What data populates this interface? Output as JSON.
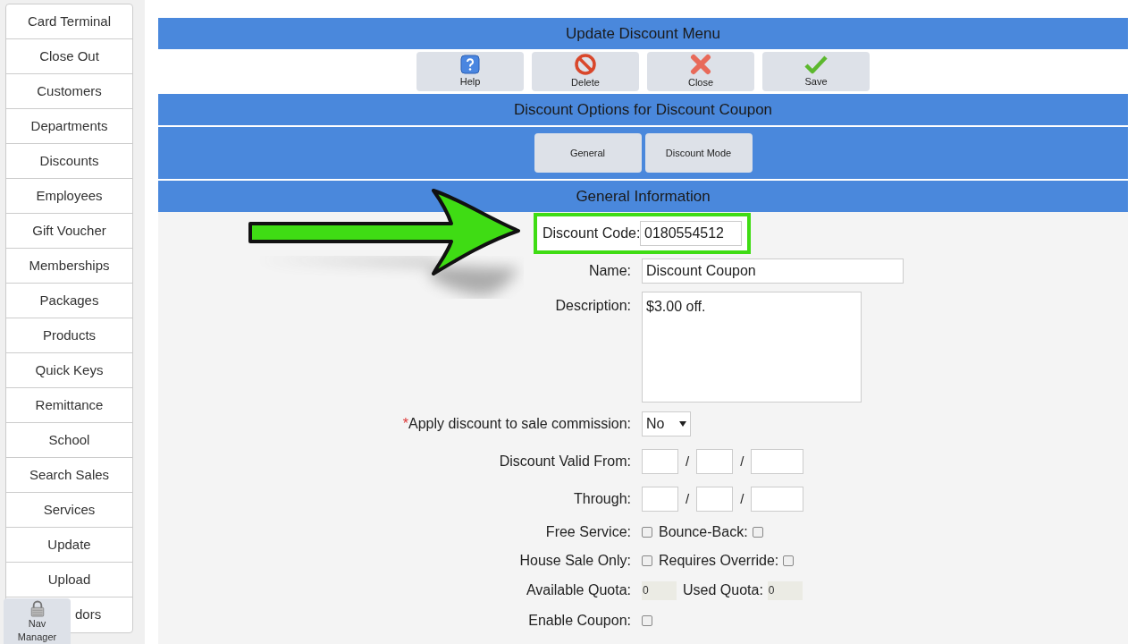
{
  "sidebar": {
    "items": [
      {
        "label": "Card Terminal"
      },
      {
        "label": "Close Out"
      },
      {
        "label": "Customers"
      },
      {
        "label": "Departments"
      },
      {
        "label": "Discounts"
      },
      {
        "label": "Employees"
      },
      {
        "label": "Gift Voucher"
      },
      {
        "label": "Memberships"
      },
      {
        "label": "Packages"
      },
      {
        "label": "Products"
      },
      {
        "label": "Quick Keys"
      },
      {
        "label": "Remittance"
      },
      {
        "label": "School"
      },
      {
        "label": "Search Sales"
      },
      {
        "label": "Services"
      },
      {
        "label": "Update"
      },
      {
        "label": "Upload"
      },
      {
        "label": "dors"
      }
    ],
    "nav_manager": {
      "label": "Nav Manager"
    }
  },
  "header": {
    "title": "Update Discount Menu"
  },
  "toolbar": [
    {
      "kind": "help",
      "label": "Help"
    },
    {
      "kind": "delete",
      "label": "Delete"
    },
    {
      "kind": "close",
      "label": "Close"
    },
    {
      "kind": "save",
      "label": "Save"
    }
  ],
  "options": {
    "title": "Discount Options for Discount Coupon",
    "tabs": [
      {
        "label": "General"
      },
      {
        "label": "Discount Mode"
      }
    ]
  },
  "section": {
    "title": "General Information"
  },
  "form": {
    "discount_code": {
      "label": "Discount Code:",
      "value": "0180554512",
      "highlighted": true
    },
    "name": {
      "label": "Name:",
      "value": "Discount Coupon"
    },
    "description": {
      "label": "Description:",
      "value": "$3.00 off."
    },
    "commission": {
      "required_mark": "*",
      "label": "Apply discount to sale commission:",
      "value": "No"
    },
    "valid_from": {
      "label": "Discount Valid From:",
      "separators": [
        "/",
        "/"
      ]
    },
    "through": {
      "label": "Through:",
      "separators": [
        "/",
        "/"
      ]
    },
    "checks": [
      [
        {
          "label": "Free Service:",
          "checked": false
        },
        {
          "label": "Bounce-Back:",
          "checked": false
        }
      ],
      [
        {
          "label": "House Sale Only:",
          "checked": false
        },
        {
          "label": "Requires Override:",
          "checked": false
        }
      ]
    ],
    "quota": [
      {
        "label": "Available Quota:",
        "value": "0"
      },
      {
        "label": "Used Quota:",
        "value": "0"
      }
    ],
    "enable_coupon": {
      "label": "Enable Coupon:",
      "checked": false
    }
  }
}
